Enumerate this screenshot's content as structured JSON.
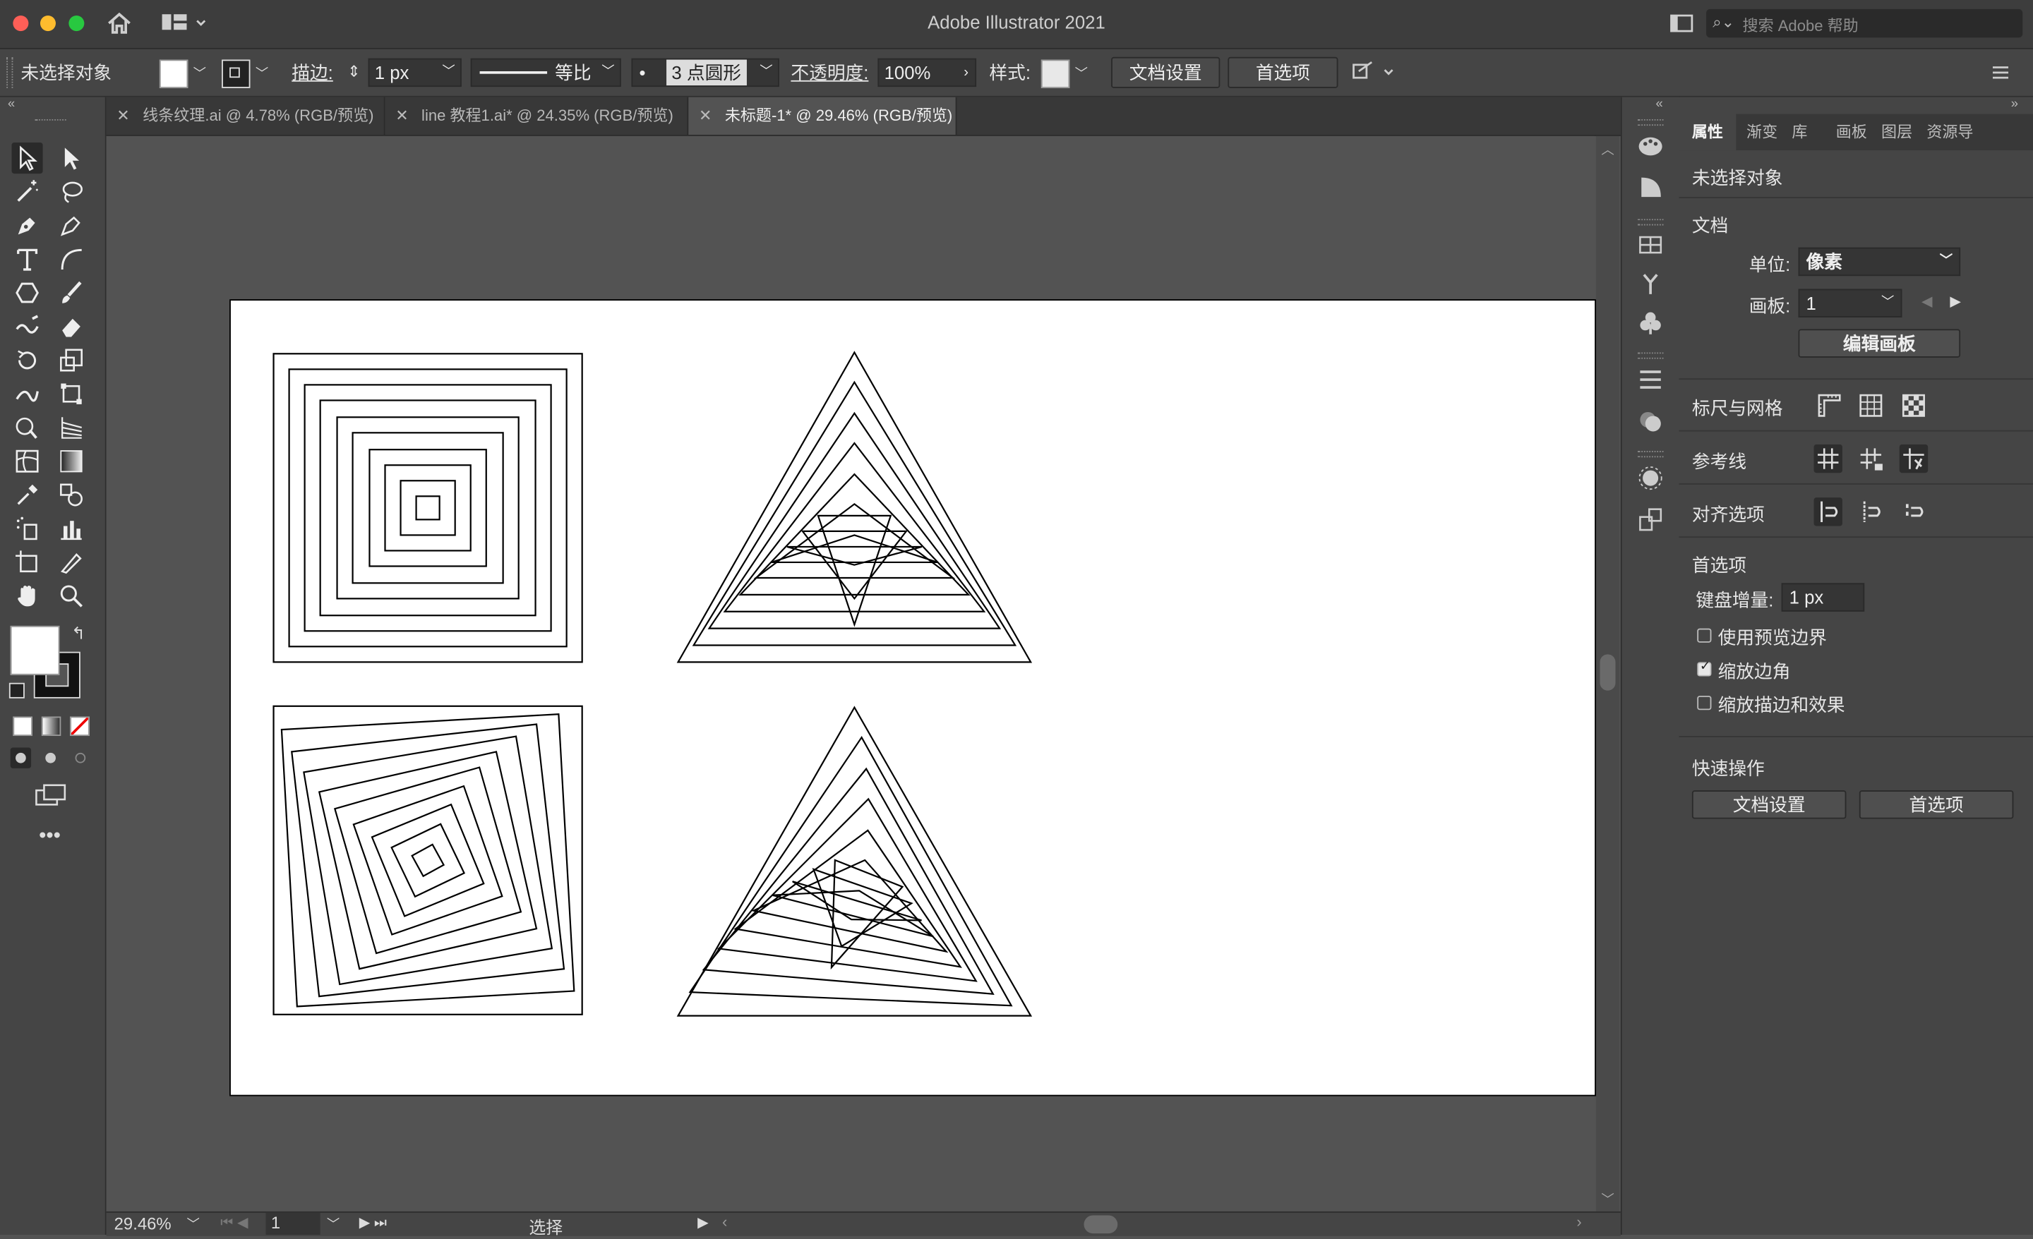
{
  "window": {
    "title": "Adobe Illustrator 2021"
  },
  "help_search": {
    "placeholder": "搜索 Adobe 帮助"
  },
  "control_bar": {
    "selection_label": "未选择对象",
    "stroke_label": "描边:",
    "stroke_weight": "1 px",
    "stroke_profile": "等比",
    "brush": "3 点圆形",
    "opacity_label": "不透明度:",
    "opacity_value": "100%",
    "style_label": "样式:",
    "doc_setup_button": "文档设置",
    "prefs_button": "首选项"
  },
  "tabs": [
    {
      "label": "线条纹理.ai @ 4.78% (RGB/预览)"
    },
    {
      "label": "line 教程1.ai* @ 24.35% (RGB/预览)"
    },
    {
      "label": "未标题-1* @ 29.46% (RGB/预览)",
      "active": true
    }
  ],
  "status_bar": {
    "zoom": "29.46%",
    "artboard_number": "1",
    "tool_name": "选择"
  },
  "properties_panel": {
    "tabs": [
      "属性",
      "渐变",
      "库",
      "画板",
      "图层",
      "资源导"
    ],
    "selection_title": "未选择对象",
    "document_section": "文档",
    "units_label": "单位:",
    "units_value": "像素",
    "artboard_label": "画板:",
    "artboard_value": "1",
    "edit_artboards_button": "编辑画板",
    "rulers_grids_label": "标尺与网格",
    "guides_label": "参考线",
    "snap_label": "对齐选项",
    "prefs_section": "首选项",
    "keyboard_increment_label": "键盘增量:",
    "keyboard_increment_value": "1 px",
    "checkboxes": [
      {
        "label": "使用预览边界",
        "checked": false
      },
      {
        "label": "缩放边角",
        "checked": true
      },
      {
        "label": "缩放描边和效果",
        "checked": false
      }
    ],
    "quick_actions_section": "快速操作",
    "quick_doc_setup_button": "文档设置",
    "quick_prefs_button": "首选项"
  },
  "colors": {
    "app_bg": "#535353",
    "panel_bg": "#454545",
    "title_bg": "#3d3d3d",
    "artboard": "#ffffff",
    "stroke": "#000000"
  }
}
